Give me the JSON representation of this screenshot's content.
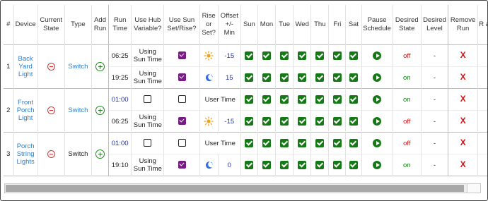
{
  "headers": {
    "num": "#",
    "device": "Device",
    "current_state": "Current State",
    "type": "Type",
    "add_run": "Add Run",
    "run_time": "Run Time",
    "use_hub": "Use Hub Variable?",
    "use_sun": "Use Sun Set/Rise?",
    "rise_set": "Rise or Set?",
    "offset": "Offset +/- Min",
    "sun": "Sun",
    "mon": "Mon",
    "tue": "Tue",
    "wed": "Wed",
    "thu": "Thu",
    "fri": "Fri",
    "sat": "Sat",
    "pause": "Pause Schedule",
    "desired_state": "Desired State",
    "desired_level": "Desired Level",
    "remove_run": "Remove Run",
    "cut": "R a"
  },
  "devices": [
    {
      "num": "1",
      "name": "Back Yard Light",
      "type": "Switch",
      "type_link": true,
      "runs": [
        {
          "time": "06:25",
          "time_style": "dark",
          "hub": "Using Sun Time",
          "sun_checked": true,
          "rise_set": "sun",
          "offset": "-15",
          "offset_color": "#2030b0",
          "state": "off",
          "level": "-"
        },
        {
          "time": "19:25",
          "time_style": "dark",
          "hub": "Using Sun Time",
          "sun_checked": true,
          "rise_set": "moon",
          "offset": "15",
          "offset_color": "#2030b0",
          "state": "on",
          "level": "-"
        }
      ]
    },
    {
      "num": "2",
      "name": "Front Porch Light",
      "type": "Switch",
      "type_link": true,
      "runs": [
        {
          "time": "01:00",
          "time_style": "blue",
          "hub": "",
          "hub_checkbox": true,
          "sun_checked": false,
          "rise_set": "",
          "offset_label": "User Time",
          "state": "on",
          "level": "-"
        },
        {
          "time": "06:25",
          "time_style": "dark",
          "hub": "Using Sun Time",
          "sun_checked": true,
          "rise_set": "sun",
          "offset": "-15",
          "offset_color": "#2030b0",
          "state": "off",
          "level": "-"
        }
      ]
    },
    {
      "num": "3",
      "name": "Porch String Lights",
      "type": "Switch",
      "type_link": false,
      "runs": [
        {
          "time": "01:00",
          "time_style": "blue",
          "hub": "",
          "hub_checkbox": true,
          "sun_checked": false,
          "rise_set": "",
          "offset_label": "User Time",
          "state": "off",
          "level": "-"
        },
        {
          "time": "19:10",
          "time_style": "dark",
          "hub": "Using Sun Time",
          "sun_checked": true,
          "rise_set": "moon",
          "offset": "0",
          "offset_color": "#2030b0",
          "state": "on",
          "level": "-"
        }
      ]
    }
  ],
  "remove_symbol": "X",
  "colors": {
    "check_green": "#157a15",
    "check_purple": "#7a1a86",
    "link_blue": "#2a7fce",
    "off_red": "#e01010",
    "on_green": "#0a8a0a"
  },
  "icons": {
    "add": "plus-circle-icon",
    "state": "minus-circle-icon",
    "sunrise": "sun-icon",
    "sunset": "moon-icon",
    "pause": "play-circle-icon"
  }
}
